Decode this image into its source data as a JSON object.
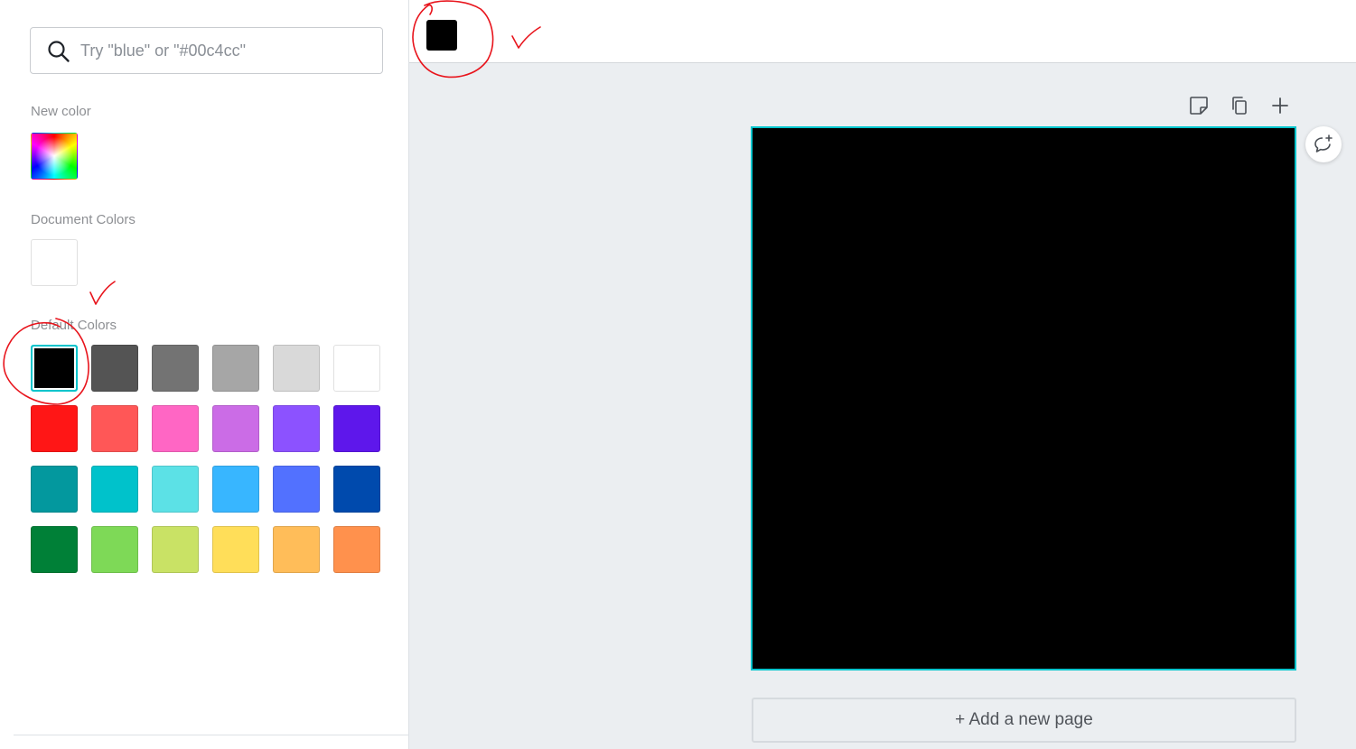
{
  "color_panel": {
    "search": {
      "placeholder": "Try \"blue\" or \"#00c4cc\"",
      "icon": "search-icon"
    },
    "new_color_label": "New color",
    "document_colors_label": "Document Colors",
    "document_colors": [
      "#ffffff"
    ],
    "default_colors_label": "Default Colors",
    "selected_color": "#000000",
    "default_colors": [
      [
        "#000000",
        "#545454",
        "#737373",
        "#a6a6a6",
        "#d9d9d9",
        "#ffffff"
      ],
      [
        "#ff1616",
        "#ff5757",
        "#ff66c4",
        "#cb6ce6",
        "#8c52ff",
        "#5e17eb"
      ],
      [
        "#03989e",
        "#00c2cb",
        "#5ce1e6",
        "#38b6ff",
        "#5271ff",
        "#004aad"
      ],
      [
        "#008037",
        "#7ed957",
        "#c9e265",
        "#ffde59",
        "#ffbd59",
        "#ff914d"
      ]
    ]
  },
  "toolbar": {
    "text_color": "#000000"
  },
  "canvas": {
    "page_background": "#000000",
    "page_tools": [
      "note-icon",
      "duplicate-icon",
      "plus-icon"
    ],
    "comment_icon": "add-comment-icon",
    "add_page_label": "+ Add a new page"
  },
  "annotation_color": "#e8141c"
}
